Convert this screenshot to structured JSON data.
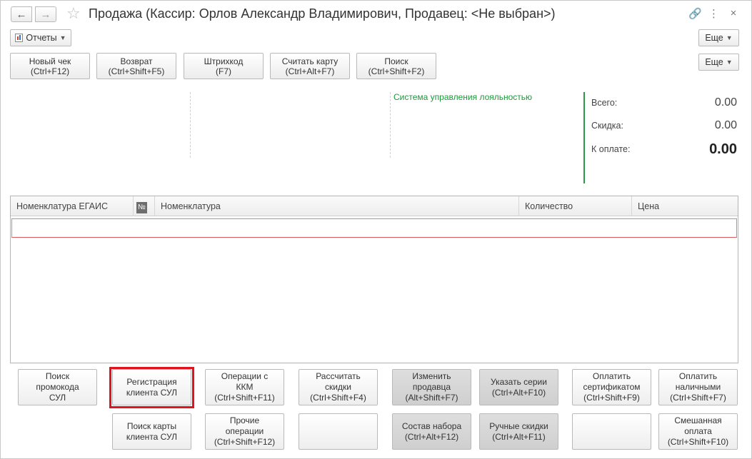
{
  "window": {
    "title": "Продажа (Кассир: Орлов Александр Владимирович, Продавец: <Не выбран>)"
  },
  "title_bar": {
    "back_icon": "arrow-left-icon",
    "forward_icon": "arrow-right-icon",
    "favorite_icon": "star-icon",
    "tools": [
      "link-icon",
      "more-icon",
      "close-icon"
    ]
  },
  "toolbar": {
    "reports_label": "Отчеты",
    "more_label_1": "Еще",
    "more_label_2": "Еще"
  },
  "top_buttons": [
    {
      "line1": "Новый чек",
      "line2": "(Ctrl+F12)"
    },
    {
      "line1": "Возврат",
      "line2": "(Ctrl+Shift+F5)"
    },
    {
      "line1": "Штрихкод",
      "line2": "(F7)"
    },
    {
      "line1": "Считать карту",
      "line2": "(Ctrl+Alt+F7)"
    },
    {
      "line1": "Поиск",
      "line2": "(Ctrl+Shift+F2)"
    }
  ],
  "loyalty": {
    "label": "Система управления лояльностью"
  },
  "totals": {
    "total_label": "Всего:",
    "total_value": "0.00",
    "discount_label": "Скидка:",
    "discount_value": "0.00",
    "pay_label": "К оплате:",
    "pay_value": "0.00"
  },
  "table": {
    "columns": [
      "Номенклатура ЕГАИС",
      "№",
      "Номенклатура",
      "Количество",
      "Цена"
    ]
  },
  "bottom_buttons": {
    "row1": [
      {
        "lines": [
          "Поиск",
          "промокода",
          "СУЛ"
        ],
        "style": "normal"
      },
      {
        "lines": [
          "Регистрация",
          "клиента СУЛ"
        ],
        "style": "normal"
      },
      {
        "lines": [
          "Операции с",
          "ККМ",
          "(Ctrl+Shift+F11)"
        ],
        "style": "normal"
      },
      {
        "lines": [
          "Рассчитать",
          "скидки",
          "(Ctrl+Shift+F4)"
        ],
        "style": "normal"
      },
      {
        "lines": [
          "Изменить",
          "продавца",
          "(Alt+Shift+F7)"
        ],
        "style": "gray"
      },
      {
        "lines": [
          "Указать серии",
          "(Ctrl+Alt+F10)"
        ],
        "style": "gray"
      },
      {
        "lines": [
          "Оплатить",
          "сертификатом",
          "(Ctrl+Shift+F9)"
        ],
        "style": "normal"
      },
      {
        "lines": [
          "Оплатить",
          "наличными",
          "(Ctrl+Shift+F7)"
        ],
        "style": "normal"
      }
    ],
    "row2": [
      {
        "lines": [
          "Поиск карты",
          "клиента СУЛ"
        ],
        "style": "normal"
      },
      {
        "lines": [
          "Прочие",
          "операции",
          "(Ctrl+Shift+F12)"
        ],
        "style": "normal"
      },
      {
        "lines": [],
        "style": "normal"
      },
      {
        "lines": [
          "Состав набора",
          "(Ctrl+Alt+F12)"
        ],
        "style": "gray"
      },
      {
        "lines": [
          "Ручные скидки",
          "(Ctrl+Alt+F11)"
        ],
        "style": "gray"
      },
      {
        "lines": [],
        "style": "normal"
      },
      {
        "lines": [
          "Смешанная",
          "оплата",
          "(Ctrl+Shift+F10)"
        ],
        "style": "normal"
      }
    ]
  },
  "highlight_color": "#e0141e",
  "accent_color": "#2a9a4a"
}
